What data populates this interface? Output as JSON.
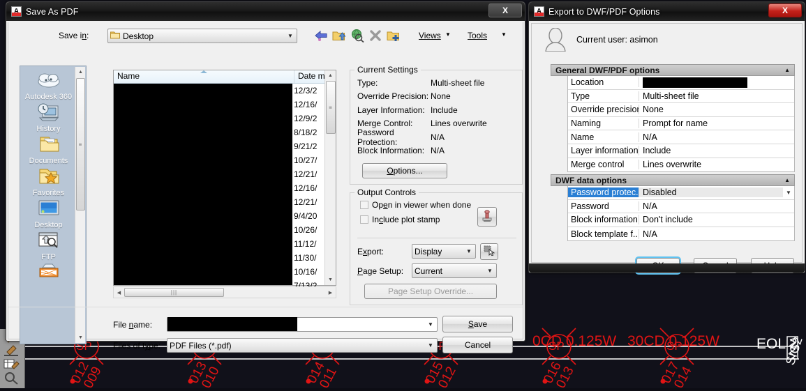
{
  "cad_background": {
    "labels_top": [
      "0CD 0.125W",
      "30CD 0.125W"
    ],
    "eol_label": "EOL 2",
    "sig_label": "SIG2",
    "sp_marker": "SP",
    "device_tags": [
      {
        "upper": "012",
        "lower": "009"
      },
      {
        "upper": "013",
        "lower": "010"
      },
      {
        "upper": "014",
        "lower": "011"
      },
      {
        "upper": "015",
        "lower": "012"
      },
      {
        "upper": "016",
        "lower": "013"
      },
      {
        "upper": "017",
        "lower": "014"
      }
    ]
  },
  "save_dialog": {
    "title": "Save As PDF",
    "close_label": "X",
    "save_in_label": "Save in:",
    "save_in_value": "Desktop",
    "toolbar": {
      "back_icon": "back-arrow-icon",
      "up_icon": "up-one-level-icon",
      "search_icon": "search-web-icon",
      "delete_icon": "delete-icon",
      "new_folder_icon": "new-folder-icon",
      "views_label": "Views",
      "tools_label": "Tools"
    },
    "places": [
      {
        "label": "Autodesk 360",
        "icon": "cloud-icon"
      },
      {
        "label": "History",
        "icon": "history-icon"
      },
      {
        "label": "Documents",
        "icon": "documents-folder-icon"
      },
      {
        "label": "Favorites",
        "icon": "favorites-folder-icon"
      },
      {
        "label": "Desktop",
        "icon": "desktop-icon"
      },
      {
        "label": "FTP",
        "icon": "ftp-icon"
      },
      {
        "label": "",
        "icon": "buzzsaw-icon"
      }
    ],
    "file_list": {
      "columns": [
        "Name",
        "Date m"
      ],
      "dates": [
        "12/3/2",
        "12/16/",
        "12/9/2",
        "8/18/2",
        "9/21/2",
        "10/27/",
        "12/21/",
        "12/16/",
        "12/21/",
        "9/4/20",
        "10/26/",
        "11/12/",
        "11/30/",
        "10/16/",
        "7/13/2"
      ]
    },
    "current_settings": {
      "group_title": "Current Settings",
      "rows": [
        {
          "key": "Type:",
          "value": "Multi-sheet file"
        },
        {
          "key": "Override Precision:",
          "value": "None"
        },
        {
          "key": "Layer Information:",
          "value": "Include"
        },
        {
          "key": "Merge Control:",
          "value": "Lines overwrite"
        },
        {
          "key": "Password Protection:",
          "value": "N/A"
        },
        {
          "key": "Block Information:",
          "value": "N/A"
        }
      ],
      "options_button": "Options..."
    },
    "output_controls": {
      "group_title": "Output Controls",
      "checkbox_open_viewer": "Open in viewer when done",
      "checkbox_plot_stamp": "Include plot stamp",
      "plot_stamp_icon": "plot-stamp-icon",
      "export_label": "Export:",
      "export_value": "Display",
      "pick_icon": "window-pick-icon",
      "page_setup_label": "Page Setup:",
      "page_setup_value": "Current",
      "page_setup_override": "Page Setup Override..."
    },
    "footer": {
      "file_name_label": "File name:",
      "file_name_value": "",
      "files_of_type_label": "Files of type:",
      "files_of_type_value": "PDF Files (*.pdf)",
      "save_button": "Save",
      "cancel_button": "Cancel"
    }
  },
  "export_dialog": {
    "title": "Export to DWF/PDF Options",
    "close_label": "X",
    "current_user": "Current user: asimon",
    "user_icon": "user-avatar-icon",
    "general_section": {
      "title": "General DWF/PDF options",
      "collapse_icon": "chevron-up-icon",
      "rows": [
        {
          "key": "Location",
          "value": "",
          "redacted": true
        },
        {
          "key": "Type",
          "value": "Multi-sheet file"
        },
        {
          "key": "Override precision",
          "value": "None"
        },
        {
          "key": "Naming",
          "value": "Prompt for name"
        },
        {
          "key": "Name",
          "value": "N/A"
        },
        {
          "key": "Layer information",
          "value": "Include"
        },
        {
          "key": "Merge control",
          "value": "Lines overwrite"
        }
      ]
    },
    "dwf_section": {
      "title": "DWF data options",
      "collapse_icon": "chevron-up-icon",
      "rows": [
        {
          "key": "Password protec...",
          "value": "Disabled",
          "selected": true,
          "dropdown": true
        },
        {
          "key": "Password",
          "value": "N/A"
        },
        {
          "key": "Block information",
          "value": "Don't include"
        },
        {
          "key": "Block template f...",
          "value": "N/A"
        }
      ]
    },
    "buttons": {
      "ok": "OK",
      "cancel": "Cancel",
      "help": "Help"
    }
  },
  "annotation": {
    "color": "#14A3DC",
    "shapes": [
      "ellipse-around-options-button",
      "curved-arrow",
      "large-ellipse-around-dwf-data-options"
    ]
  }
}
